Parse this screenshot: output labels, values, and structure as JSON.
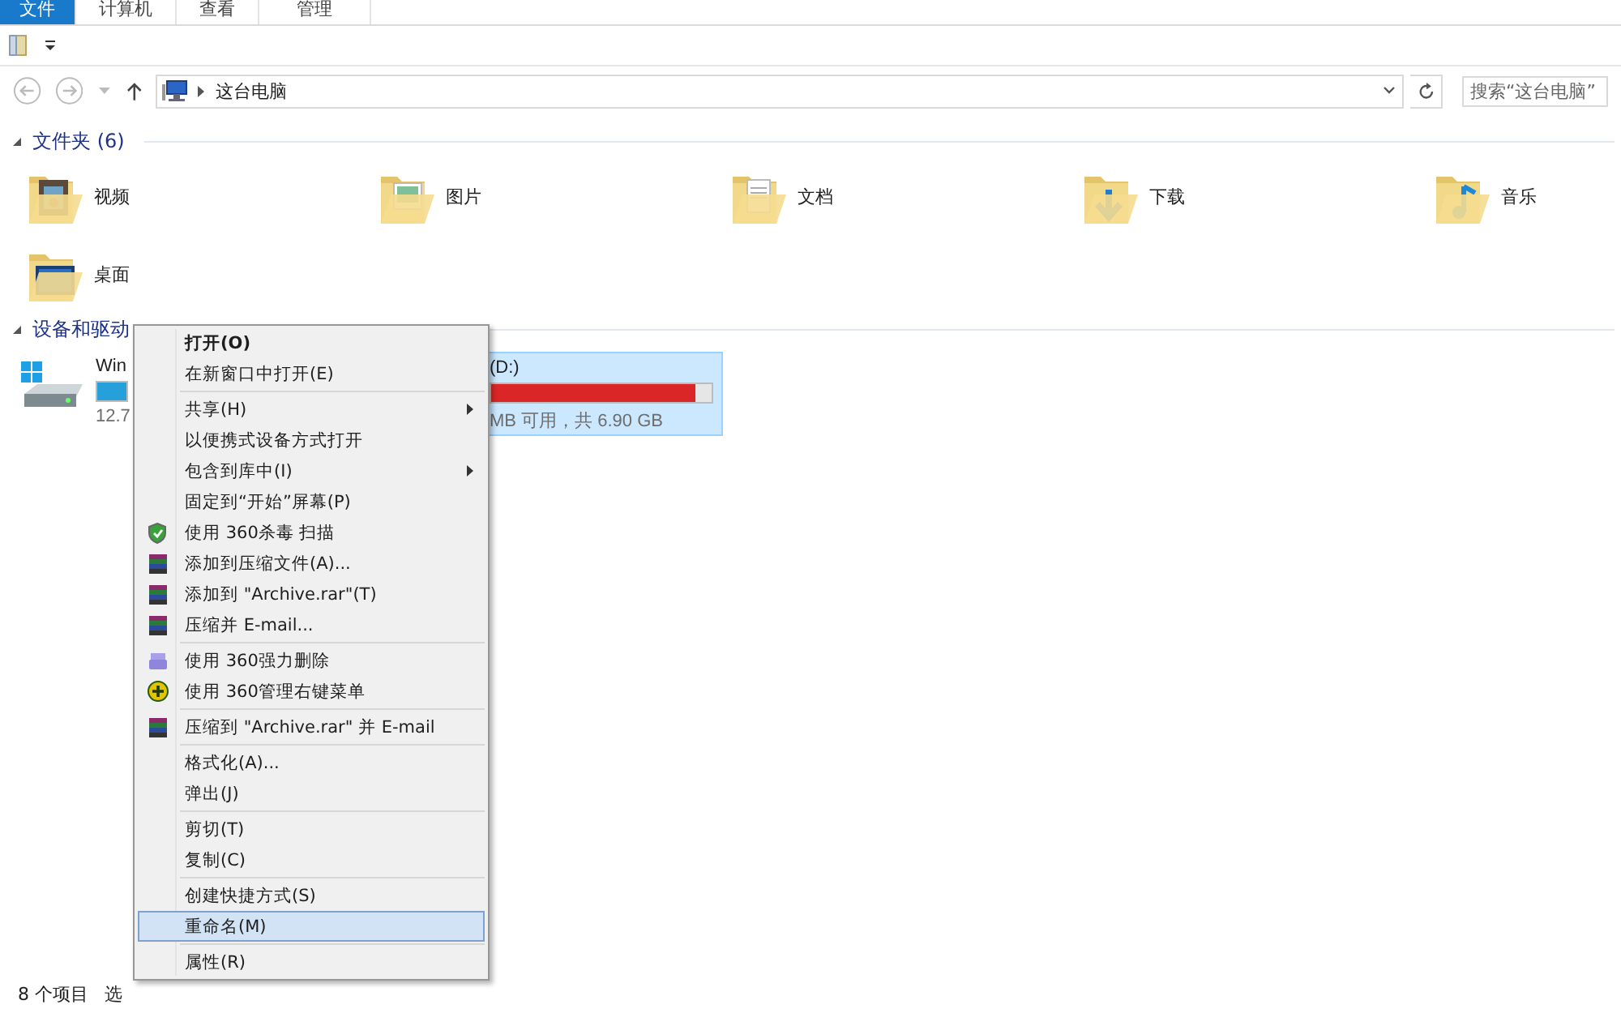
{
  "ribbon_tabs": [
    {
      "label": "文件",
      "selected": true
    },
    {
      "label": "计算机",
      "selected": false
    },
    {
      "label": "查看",
      "selected": false
    },
    {
      "label": "管理",
      "selected": false
    }
  ],
  "address_bar": {
    "path": "这台电脑"
  },
  "search": {
    "placeholder": "搜索“这台电脑”"
  },
  "sections": [
    {
      "title": "文件夹 (6)",
      "expanded": true,
      "kind": "folders",
      "items": [
        {
          "name": "视频",
          "kind": "video"
        },
        {
          "name": "图片",
          "kind": "pictures"
        },
        {
          "name": "文档",
          "kind": "documents"
        },
        {
          "name": "下载",
          "kind": "downloads"
        },
        {
          "name": "音乐",
          "kind": "music"
        },
        {
          "name": "桌面",
          "kind": "desktop"
        }
      ]
    },
    {
      "title": "设备和驱动",
      "expanded": true,
      "kind": "drives",
      "items": [
        {
          "name": "Win",
          "detail": "12.7",
          "kind": "system",
          "selected": false,
          "low_space": false
        },
        {
          "name": "(D:)",
          "detail": "MB 可用，共 6.90 GB",
          "kind": "plain",
          "selected": true,
          "low_space": true,
          "level": 0.93
        }
      ]
    }
  ],
  "context_menu": [
    {
      "kind": "item",
      "label": "打开(O)",
      "default": true
    },
    {
      "kind": "item",
      "label": "在新窗口中打开(E)"
    },
    {
      "kind": "separator"
    },
    {
      "kind": "item",
      "label": "共享(H)",
      "submenu": true
    },
    {
      "kind": "item",
      "label": "以便携式设备方式打开"
    },
    {
      "kind": "item",
      "label": "包含到库中(I)",
      "submenu": true
    },
    {
      "kind": "item",
      "label": "固定到“开始”屏幕(P)"
    },
    {
      "kind": "antivirus",
      "label": "使用 360杀毒 扫描"
    },
    {
      "kind": "archive",
      "label": "添加到压缩文件(A)..."
    },
    {
      "kind": "archive",
      "label": "添加到 \"Archive.rar\"(T)"
    },
    {
      "kind": "archive",
      "label": "压缩并 E-mail..."
    },
    {
      "kind": "separator"
    },
    {
      "kind": "shredder",
      "label": "使用 360强力删除"
    },
    {
      "kind": "menu_manager",
      "label": "使用 360管理右键菜单"
    },
    {
      "kind": "separator"
    },
    {
      "kind": "archive",
      "label": "压缩到 \"Archive.rar\" 并 E-mail"
    },
    {
      "kind": "separator"
    },
    {
      "kind": "item",
      "label": "格式化(A)..."
    },
    {
      "kind": "item",
      "label": "弹出(J)"
    },
    {
      "kind": "separator"
    },
    {
      "kind": "item",
      "label": "剪切(T)"
    },
    {
      "kind": "item",
      "label": "复制(C)"
    },
    {
      "kind": "separator"
    },
    {
      "kind": "item",
      "label": "创建快捷方式(S)"
    },
    {
      "kind": "item",
      "label": "重命名(M)",
      "selected": true
    },
    {
      "kind": "separator"
    },
    {
      "kind": "item",
      "label": "属性(R)"
    }
  ],
  "status_bar": {
    "item_count": "8 个项目",
    "selection": "选"
  }
}
